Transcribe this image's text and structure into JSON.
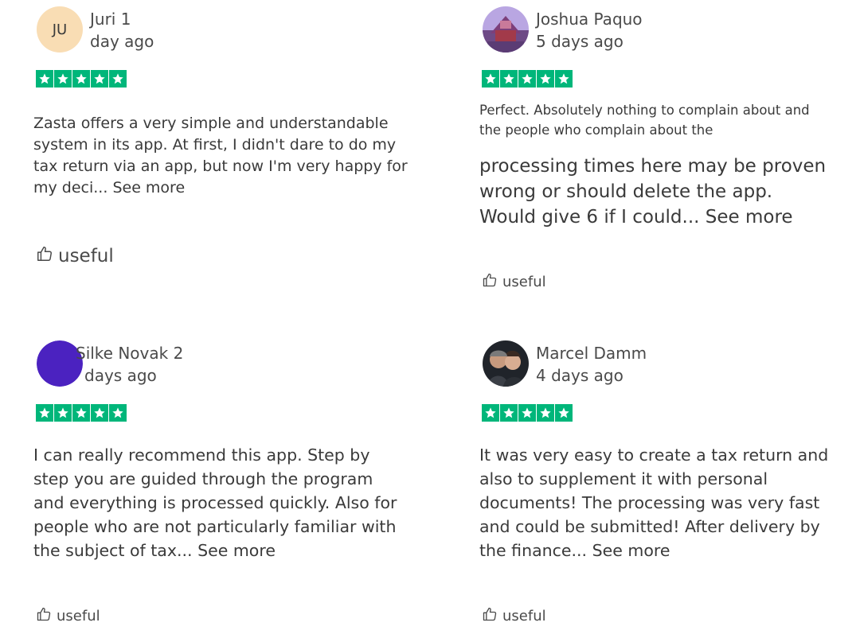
{
  "reviews": [
    {
      "author": "Juri 1",
      "date": "day ago",
      "avatar_initials": "JU",
      "avatar_type": "initials",
      "rating": 5,
      "text": "Zasta offers a very simple and understandable system in its app. At first, I didn't dare to do my tax return via an app, but now I'm very happy for my deci...",
      "see_more": "See more",
      "useful_label": "useful"
    },
    {
      "author": "Joshua Paquo",
      "date": "5 days ago",
      "avatar_type": "photo-building",
      "rating": 5,
      "lead_text": "Perfect. Absolutely nothing to complain about and the people who complain about the",
      "text": "processing times here may be proven wrong or should delete the app. Would give 6 if I could...",
      "see_more": "See more",
      "useful_label": "useful"
    },
    {
      "author": "Silke Novak 2",
      "date": "days ago",
      "avatar_type": "solid-purple",
      "rating": 5,
      "text": "I can really recommend this app. Step by step you are guided through the program and everything is processed quickly. Also for people who are not particularly familiar with the subject of tax...",
      "see_more": "See more",
      "useful_label": "useful"
    },
    {
      "author": "Marcel Damm",
      "date": "4 days ago",
      "avatar_type": "photo-couple",
      "rating": 5,
      "text": "It was very easy to create a tax return and also to supplement it with personal documents! The processing was very fast and could be submitted! After delivery by the finance...",
      "see_more": "See more",
      "useful_label": "useful"
    }
  ],
  "colors": {
    "star_green": "#00b67a",
    "avatar_initials_bg": "#f9ddb4",
    "avatar_purple": "#4b22c0",
    "text": "#3a3a3a"
  },
  "icons": {
    "star": "star-icon",
    "useful": "thumbs-up-icon"
  }
}
